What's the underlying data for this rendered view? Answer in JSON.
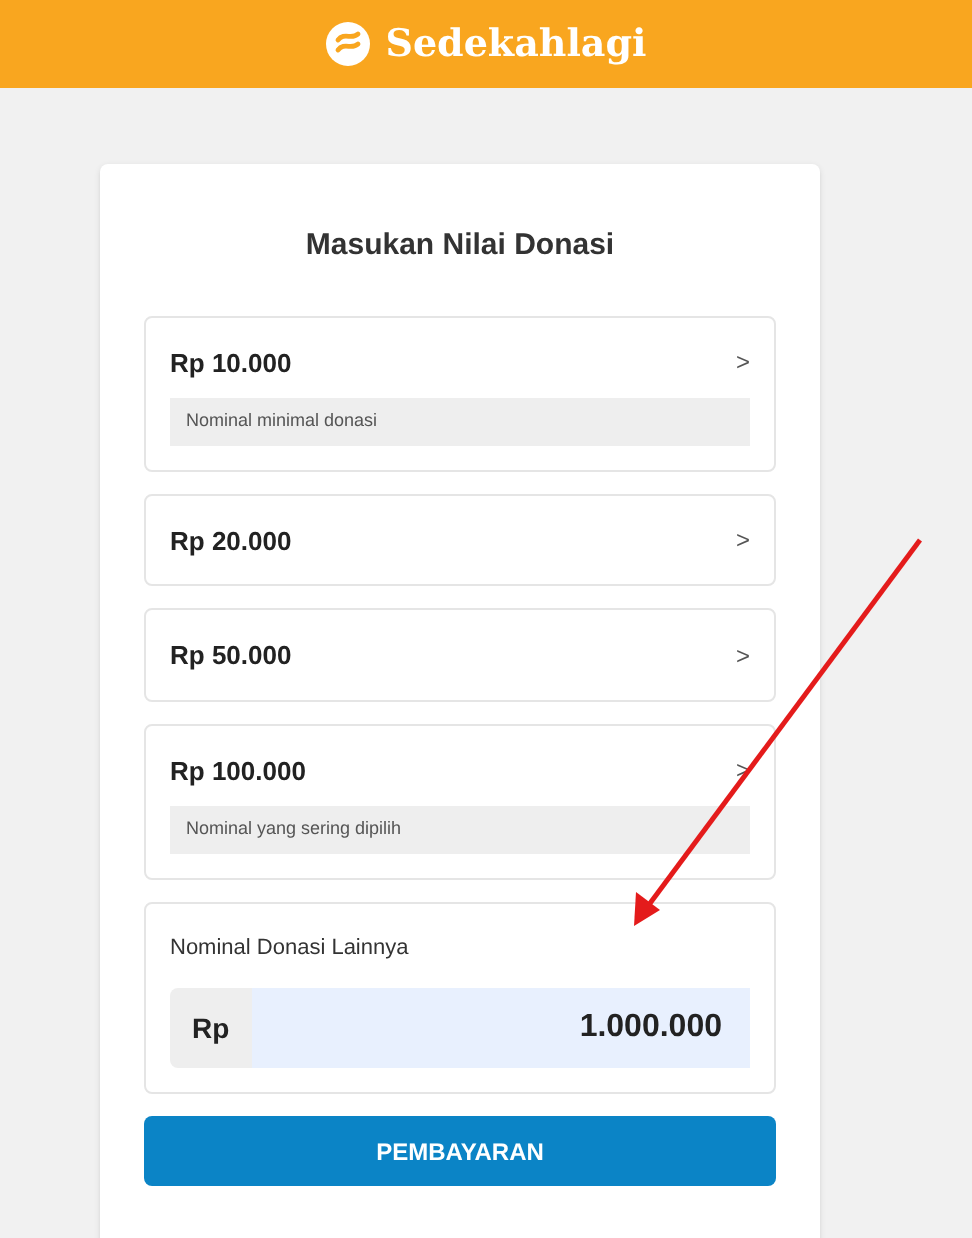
{
  "header": {
    "brand": "Sedekahlagi"
  },
  "card": {
    "title": "Masukan Nilai Donasi",
    "options": [
      {
        "amount": "Rp 10.000",
        "chevron": ">",
        "note": "Nominal minimal donasi"
      },
      {
        "amount": "Rp 20.000",
        "chevron": ">"
      },
      {
        "amount": "Rp 50.000",
        "chevron": ">"
      },
      {
        "amount": "Rp 100.000",
        "chevron": ">",
        "note": "Nominal yang sering dipilih"
      }
    ],
    "custom": {
      "label": "Nominal Donasi Lainnya",
      "prefix": "Rp",
      "value": "1.000.000"
    },
    "submit": "PEMBAYARAN"
  }
}
